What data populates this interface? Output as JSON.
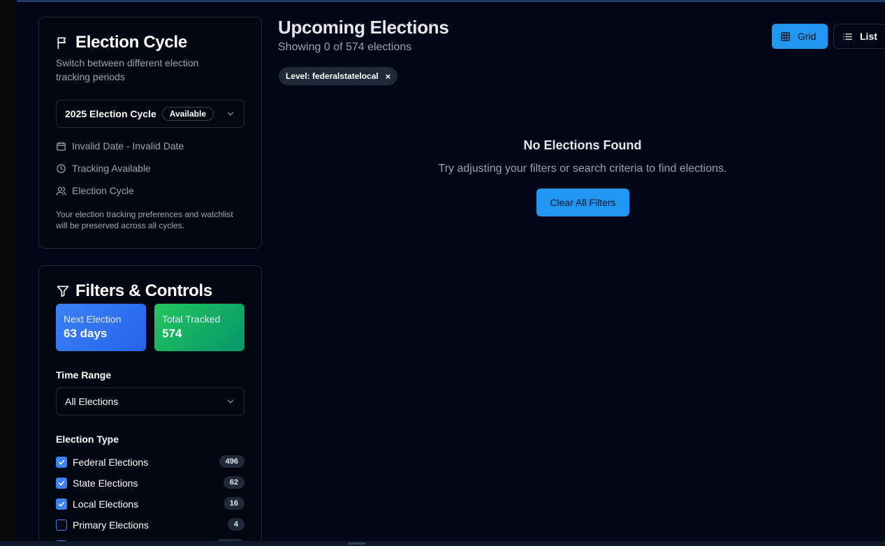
{
  "cycle_card": {
    "title": "Election Cycle",
    "description": "Switch between different election tracking periods",
    "select_value": "2025 Election Cycle",
    "select_badge": "Available",
    "date_range": "Invalid Date - Invalid Date",
    "tracking_status": "Tracking Available",
    "cycle_label": "Election Cycle",
    "note": "Your election tracking preferences and watchlist will be preserved across all cycles."
  },
  "filters_card": {
    "title": "Filters & Controls",
    "next_election_label": "Next Election",
    "next_election_value": "63 days",
    "total_tracked_label": "Total Tracked",
    "total_tracked_value": "574",
    "time_range_label": "Time Range",
    "time_range_value": "All Elections",
    "election_type_label": "Election Type",
    "types": [
      {
        "label": "Federal Elections",
        "count": "496",
        "checked": true
      },
      {
        "label": "State Elections",
        "count": "62",
        "checked": true
      },
      {
        "label": "Local Elections",
        "count": "16",
        "checked": true
      },
      {
        "label": "Primary Elections",
        "count": "4",
        "checked": false
      }
    ]
  },
  "main": {
    "title": "Upcoming Elections",
    "subtitle": "Showing 0 of 574 elections",
    "active_filter_chip": "Level: federalstatelocal",
    "chip_remove": "×",
    "view_grid_label": "Grid",
    "view_list_label": "List",
    "empty_title": "No Elections Found",
    "empty_desc": "Try adjusting your filters or search criteria to find elections.",
    "clear_button": "Clear All Filters"
  },
  "colors": {
    "background": "#020617",
    "accent_blue": "#2196f3",
    "next_election_gradient": "#3b82f6",
    "total_tracked_gradient": "#22c55e"
  },
  "icons": [
    "flag-icon",
    "chevron-down-icon",
    "calendar-icon",
    "clock-icon",
    "users-icon",
    "filter-icon",
    "check-icon",
    "grid-icon",
    "list-icon",
    "close-icon"
  ]
}
